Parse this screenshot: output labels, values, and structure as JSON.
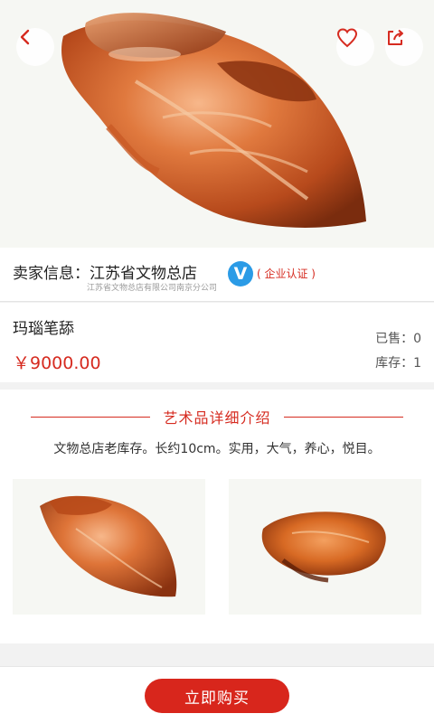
{
  "header": {
    "back_icon": "chevron-left-icon",
    "favorite_icon": "heart-icon",
    "share_icon": "share-icon",
    "accent_color": "#d62b20"
  },
  "seller": {
    "label": "卖家信息：江苏省文物总店",
    "company": "江苏省文物总店有限公司南京分公司",
    "badge": "V",
    "certification": "( 企业认证 )"
  },
  "product": {
    "name": "玛瑙笔舔",
    "price": "￥9000.00",
    "sold": "已售：0",
    "stock": "库存：1"
  },
  "detail": {
    "title": "艺术品详细介绍",
    "description": "文物总店老库存。长约10cm。实用，大气，养心，悦目。"
  },
  "footer": {
    "buy_label": "立即购买"
  }
}
